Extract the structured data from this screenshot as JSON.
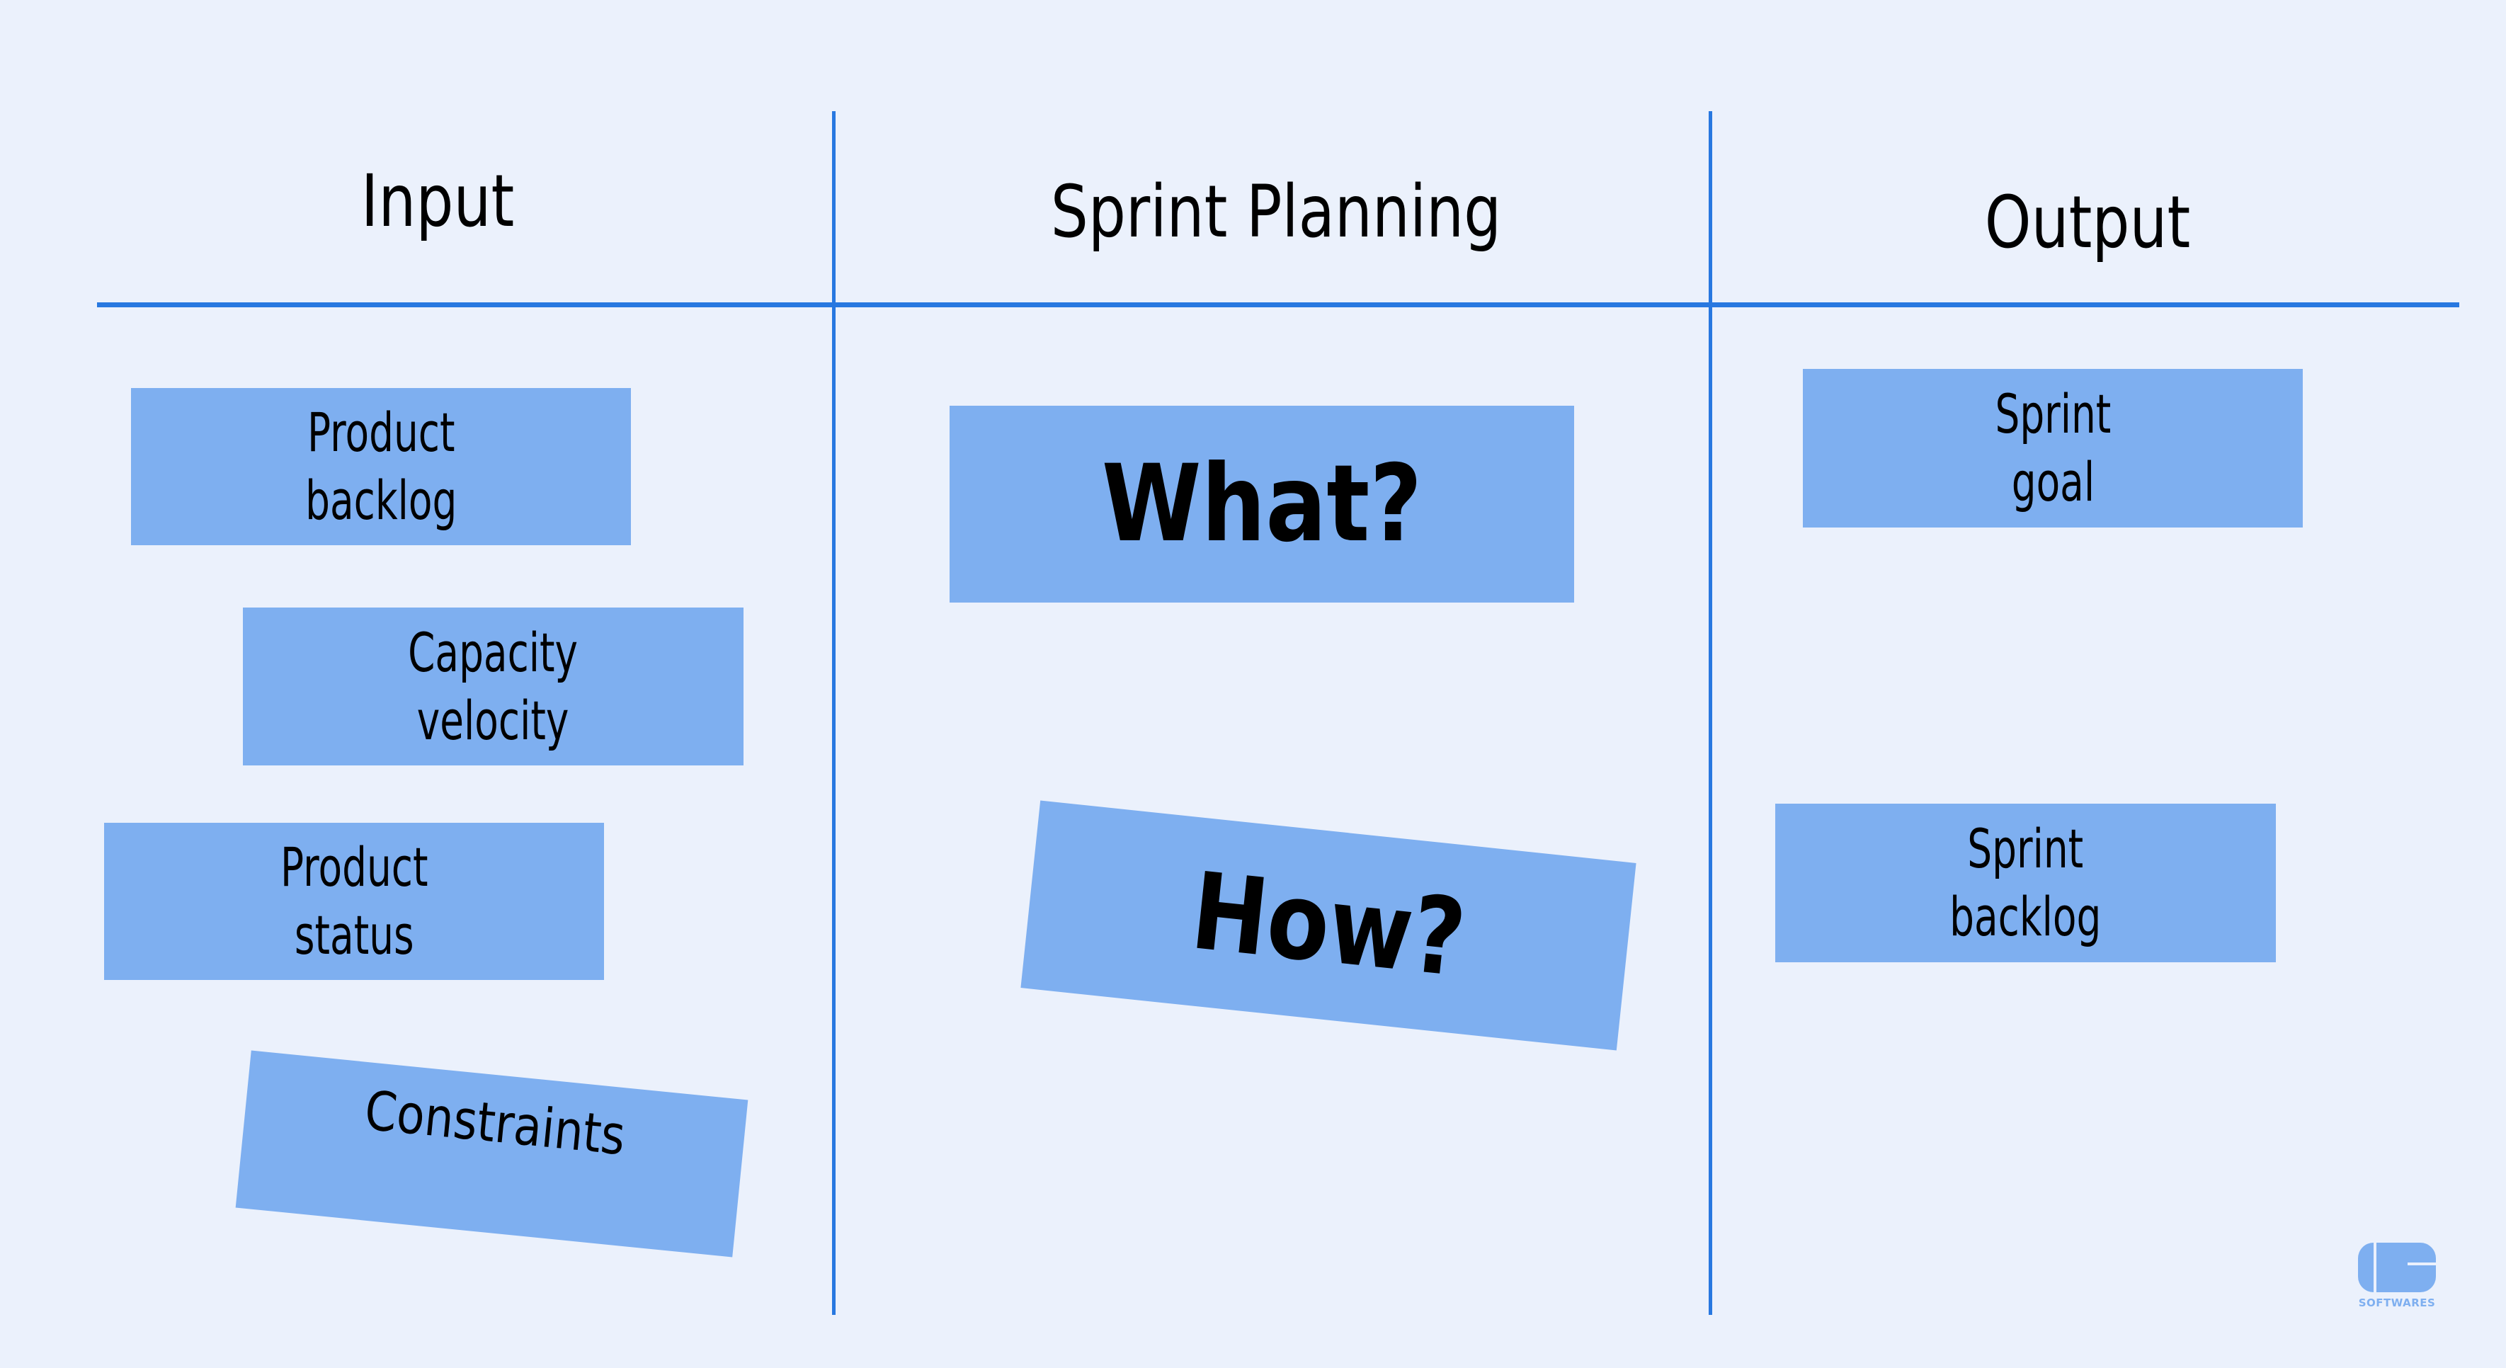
{
  "columns": [
    {
      "title": "Input"
    },
    {
      "title": "Sprint Planning"
    },
    {
      "title": "Output"
    }
  ],
  "input_notes": [
    {
      "line1": "Product",
      "line2": "backlog"
    },
    {
      "line1": "Capacity",
      "line2": "velocity"
    },
    {
      "line1": "Product",
      "line2": "status"
    },
    {
      "line1": "Constraints",
      "line2": ""
    }
  ],
  "planning_notes": [
    {
      "label": "What?"
    },
    {
      "label": "How?"
    }
  ],
  "output_notes": [
    {
      "line1": "Sprint",
      "line2": "goal"
    },
    {
      "line1": "Sprint",
      "line2": "backlog"
    }
  ],
  "logo": {
    "text": "SOFTWARES"
  },
  "colors": {
    "background": "#EBF1FC",
    "line": "#2878E0",
    "note": "#7EAFF0"
  }
}
